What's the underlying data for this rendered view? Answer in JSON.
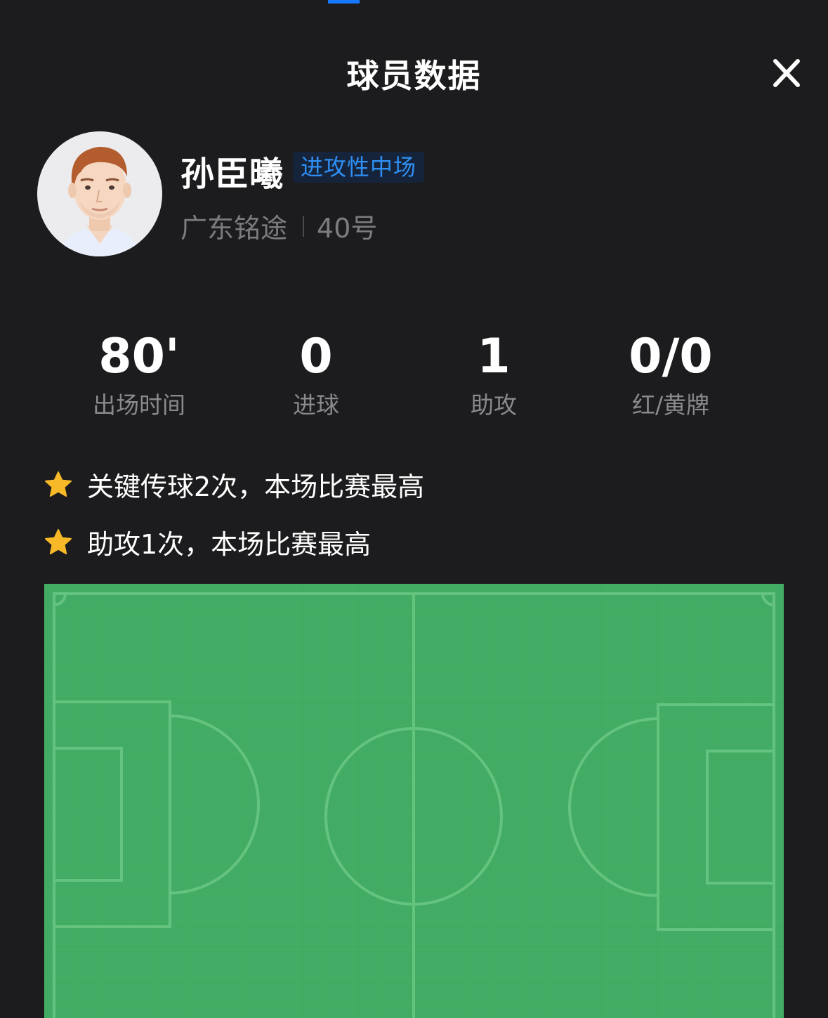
{
  "header": {
    "title": "球员数据",
    "close_icon": "close-icon"
  },
  "player": {
    "name": "孙臣曦",
    "position": "进攻性中场",
    "team": "广东铭途",
    "number": "40号",
    "avatar_icon": "player-avatar-illustration"
  },
  "stats": [
    {
      "value": "80'",
      "label": "出场时间"
    },
    {
      "value": "0",
      "label": "进球"
    },
    {
      "value": "1",
      "label": "助攻"
    },
    {
      "value": "0/0",
      "label": "红/黄牌"
    }
  ],
  "highlights": [
    {
      "icon": "star-icon",
      "text": "关键传球2次，本场比赛最高"
    },
    {
      "icon": "star-icon",
      "text": "助攻1次，本场比赛最高"
    }
  ],
  "pitch": {
    "icon": "football-pitch",
    "grass_color": "#43ac64",
    "line_color": "#64c47f"
  },
  "colors": {
    "background": "#1c1c1e",
    "accent": "#1677ff",
    "badge_text": "#2f8ff5",
    "star": "#f7b928"
  }
}
